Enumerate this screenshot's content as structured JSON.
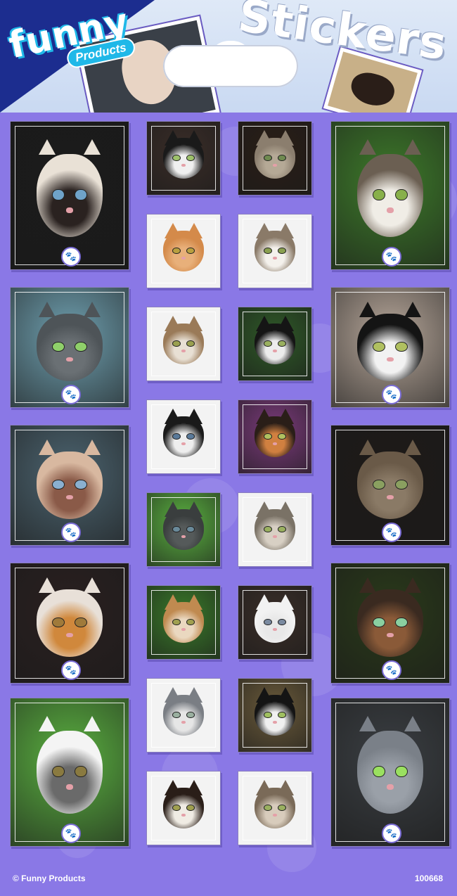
{
  "brand": {
    "name": "funny",
    "sub": "Products"
  },
  "title": "Stickers",
  "footer": {
    "copyright": "© Funny Products",
    "code": "100668"
  },
  "colors": {
    "background": "#8a78e6",
    "header": "#dfe9f7",
    "brand_dark": "#1c2d8f",
    "brand_light": "#1fb8e8"
  },
  "badge_icon": "paw-icon",
  "stickers": [
    {
      "name": "siamese",
      "fur": "#e9e1d6",
      "mask": "#2a2220",
      "eye": "#6fa3c9",
      "bg": "#1b1b1b",
      "badge": true
    },
    {
      "name": "black-white",
      "fur": "#1a1a1a",
      "mask": "#f0f0f0",
      "eye": "#9ec26b",
      "bg": "#3a2d28"
    },
    {
      "name": "tabby-lying",
      "fur": "#8b7e6e",
      "mask": "#b5a996",
      "eye": "#6f8a50",
      "bg": "#2a1e16"
    },
    {
      "name": "tabby-white",
      "fur": "#6b5f52",
      "mask": "#f0ede6",
      "eye": "#88b04a",
      "bg": "#3d7a2a",
      "badge": true
    },
    {
      "name": "orange-tabby",
      "fur": "#d48a4a",
      "mask": "#e8b07a",
      "eye": "#b9a040",
      "bg": "#f3f3f3"
    },
    {
      "name": "tabby-white-lying",
      "fur": "#8a7a68",
      "mask": "#f4f1ec",
      "eye": "#8aa050",
      "bg": "#f3f3f3"
    },
    {
      "name": "grey",
      "fur": "#4e5458",
      "mask": "#6a7074",
      "eye": "#8fd06a",
      "bg": "#6fa0b0",
      "badge": true
    },
    {
      "name": "kitten-tabby",
      "fur": "#9a7a58",
      "mask": "#e8e0d4",
      "eye": "#9aa050",
      "bg": "#f3f3f3"
    },
    {
      "name": "black-white-2",
      "fur": "#151515",
      "mask": "#ececec",
      "eye": "#9ab060",
      "bg": "#2f5a28"
    },
    {
      "name": "black-white-3",
      "fur": "#141414",
      "mask": "#f2f2f2",
      "eye": "#b0c060",
      "bg": "#b7a79a",
      "badge": true
    },
    {
      "name": "kitten-bw",
      "fur": "#1a1a1a",
      "mask": "#eeeeee",
      "eye": "#5a7a9a",
      "bg": "#f3f3f3"
    },
    {
      "name": "calico",
      "fur": "#2a1e18",
      "mask": "#d08040",
      "eye": "#b0c060",
      "bg": "#7a3a7a"
    },
    {
      "name": "siamese-2",
      "fur": "#d8b8a0",
      "mask": "#8a5a48",
      "eye": "#8ab0d0",
      "bg": "#4c6470",
      "badge": true
    },
    {
      "name": "tabby-3",
      "fur": "#6a5a48",
      "mask": "#8a7a66",
      "eye": "#8aa060",
      "bg": "#1e1a18",
      "badge": true
    },
    {
      "name": "kitten-grey",
      "fur": "#3a3e3e",
      "mask": "#555a5a",
      "eye": "#6a8a9a",
      "bg": "#5ab040"
    },
    {
      "name": "tabby-4",
      "fur": "#7a7266",
      "mask": "#d8d0c4",
      "eye": "#9ab060",
      "bg": "#f3f3f3"
    },
    {
      "name": "orange-white",
      "fur": "#e8e0d8",
      "mask": "#d0883c",
      "eye": "#a07a3a",
      "bg": "#2a2020",
      "badge": true
    },
    {
      "name": "orange-grass",
      "fur": "#c08a50",
      "mask": "#ead8c0",
      "eye": "#a0a050",
      "bg": "#3a7a2a"
    },
    {
      "name": "white-fluffy",
      "fur": "#f2f2f2",
      "mask": "#e8e8e8",
      "eye": "#7a8aa0",
      "bg": "#3a2e28"
    },
    {
      "name": "tortoiseshell",
      "fur": "#3a2a20",
      "mask": "#8a5a38",
      "eye": "#8ad0a0",
      "bg": "#2a3a1a",
      "badge": true
    },
    {
      "name": "white-grass",
      "fur": "#f4f4f4",
      "mask": "#6a6a6a",
      "eye": "#8a7a40",
      "bg": "#5ab040",
      "badge": true
    },
    {
      "name": "grey-white",
      "fur": "#7a7e84",
      "mask": "#e6e6e6",
      "eye": "#9ab0a0",
      "bg": "#f3f3f3"
    },
    {
      "name": "tuxedo",
      "fur": "#141414",
      "mask": "#f0f0f0",
      "eye": "#a0c060",
      "bg": "#6a5a3a"
    },
    {
      "name": "calico-2",
      "fur": "#2a1e18",
      "mask": "#f0ece4",
      "eye": "#a0a050",
      "bg": "#f3f3f3"
    },
    {
      "name": "tabby-5",
      "fur": "#7a6a58",
      "mask": "#d8ccbc",
      "eye": "#9ab060",
      "bg": "#f3f3f3"
    },
    {
      "name": "grey-longhair",
      "fur": "#7a8088",
      "mask": "#9aa0a8",
      "eye": "#9ae060",
      "bg": "#3a3e42",
      "badge": true
    }
  ]
}
